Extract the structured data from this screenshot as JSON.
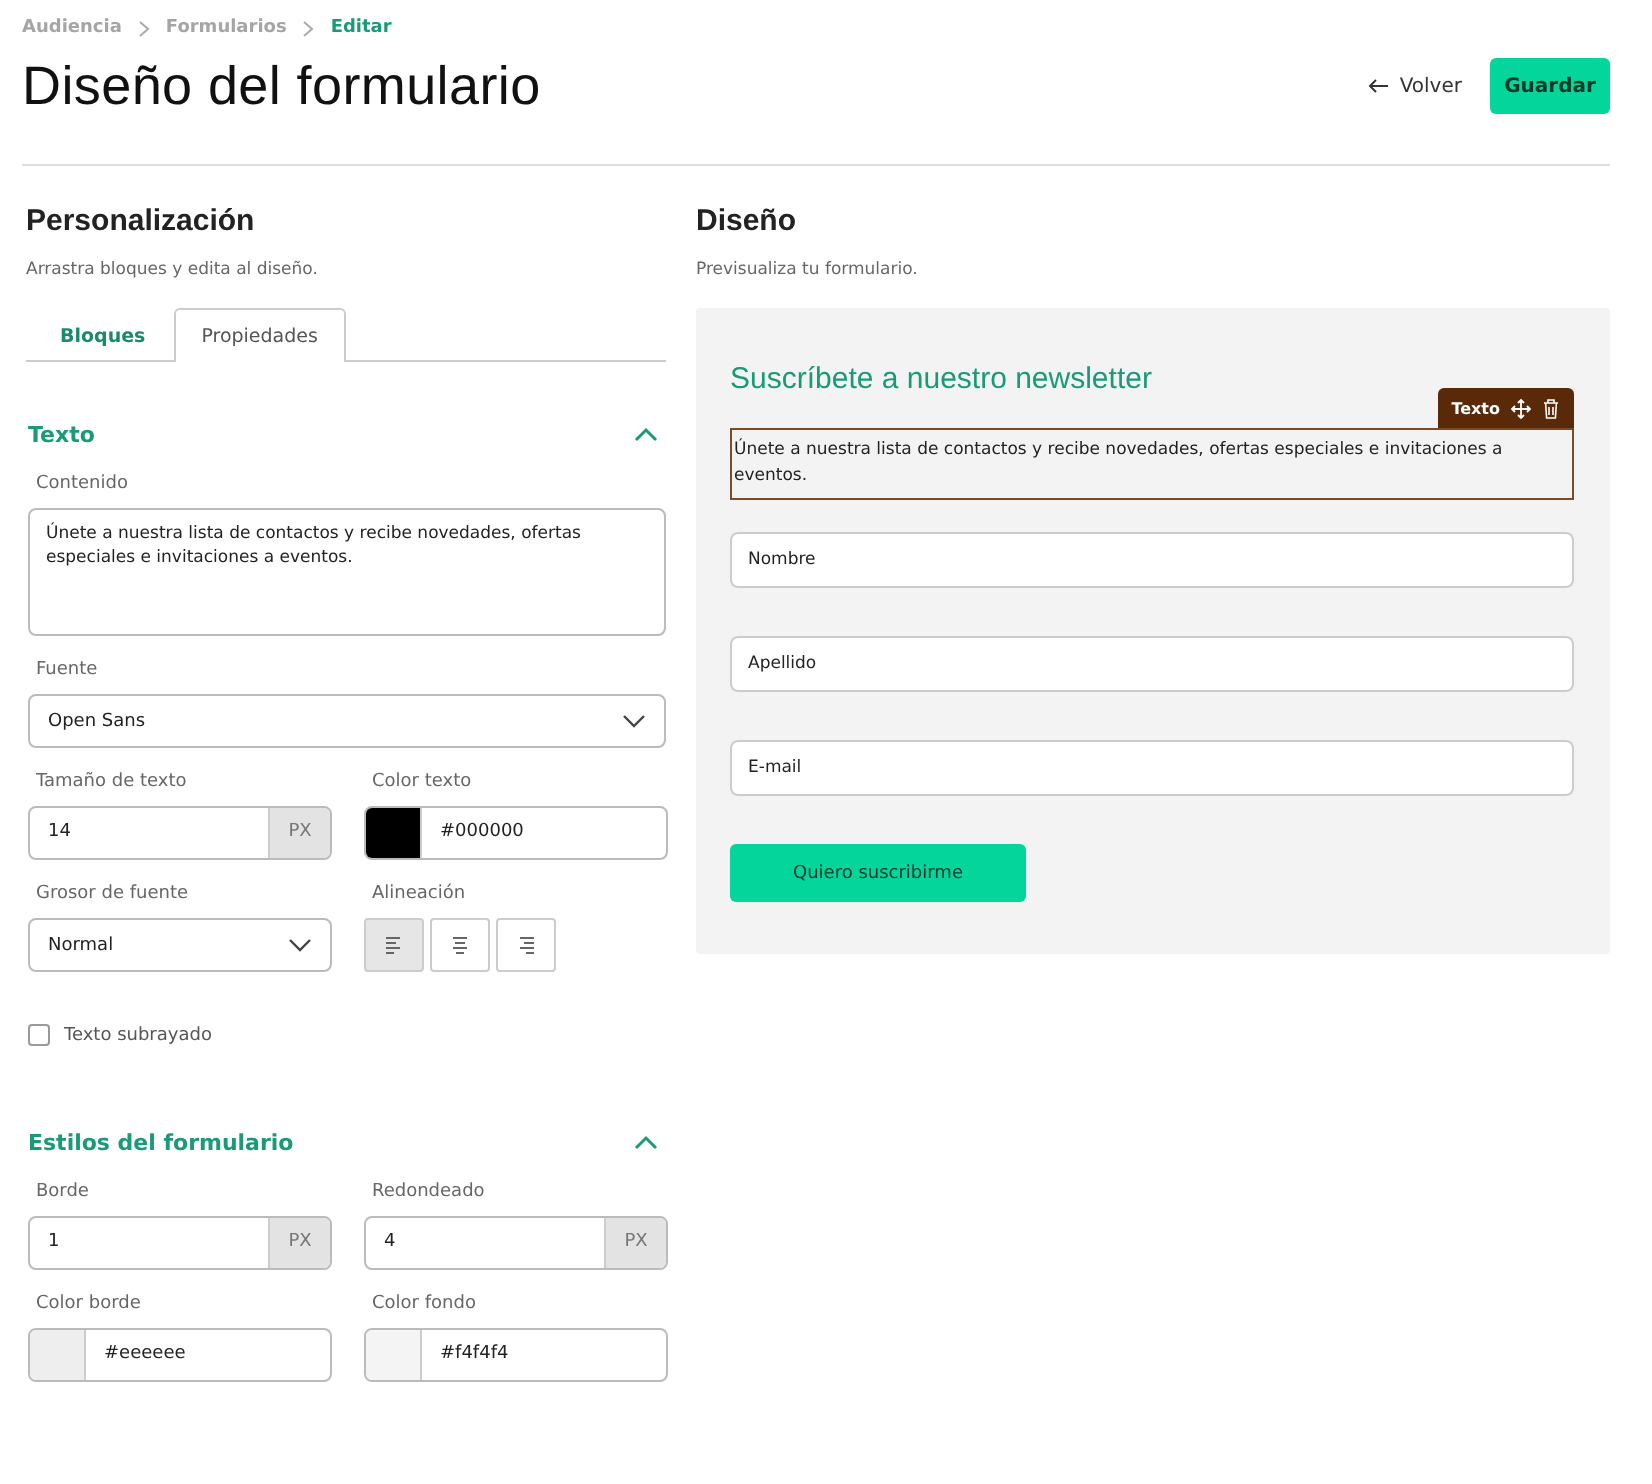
{
  "breadcrumbs": [
    {
      "label": "Audiencia",
      "current": false
    },
    {
      "label": "Formularios",
      "current": false
    },
    {
      "label": "Editar",
      "current": true
    }
  ],
  "title": "Diseño del formulario",
  "actions": {
    "back": "Volver",
    "save": "Guardar"
  },
  "editor": {
    "title": "Personalización",
    "subtitle": "Arrastra bloques y edita al diseño.",
    "tabs": [
      {
        "label": "Bloques",
        "selected": false
      },
      {
        "label": "Propiedades",
        "selected": true
      }
    ],
    "sections": [
      {
        "title": "Texto",
        "expanded": true,
        "rows": [
          [
            {
              "kind": "textarea",
              "label": "Contenido",
              "value": "Únete a nuestra lista de contactos y recibe novedades, ofertas especiales e invitaciones a eventos."
            }
          ],
          [
            {
              "kind": "select",
              "label": "Fuente",
              "value": "Open Sans"
            }
          ],
          [
            {
              "kind": "unit",
              "label": "Tamaño de texto",
              "value": "14",
              "unit": "PX"
            },
            {
              "kind": "color",
              "label": "Color texto",
              "value": "#000000",
              "color": "#000000"
            }
          ],
          [
            {
              "kind": "select",
              "label": "Grosor de fuente",
              "value": "Normal"
            },
            {
              "kind": "align",
              "label": "Alineación",
              "options": [
                {
                  "kind": "left",
                  "selected": true
                },
                {
                  "kind": "center",
                  "selected": false
                },
                {
                  "kind": "right",
                  "selected": false
                }
              ]
            }
          ],
          [
            {
              "kind": "checkbox",
              "label": "Texto subrayado",
              "checked": false
            }
          ]
        ]
      },
      {
        "title": "Estilos del formulario",
        "expanded": true,
        "rows": [
          [
            {
              "kind": "unit",
              "label": "Borde",
              "value": "1",
              "unit": "PX"
            },
            {
              "kind": "unit",
              "label": "Redondeado",
              "value": "4",
              "unit": "PX"
            }
          ],
          [
            {
              "kind": "color",
              "label": "Color borde",
              "value": "#eeeeee",
              "color": "#eeeeee"
            },
            {
              "kind": "color",
              "label": "Color fondo",
              "value": "#f4f4f4",
              "color": "#f4f4f4"
            }
          ]
        ]
      }
    ]
  },
  "preview": {
    "title": "Diseño",
    "subtitle": "Previsualiza tu formulario.",
    "form_title": "Suscríbete a nuestro newsletter",
    "text_block": {
      "text": "Únete a nuestra lista de contactos y recibe novedades, ofertas especiales e invitaciones a eventos.",
      "selected": true,
      "tag": "Texto"
    },
    "fields": [
      {
        "placeholder": "Nombre"
      },
      {
        "placeholder": "Apellido"
      },
      {
        "placeholder": "E-mail"
      }
    ],
    "button": "Quiero suscribirme"
  }
}
